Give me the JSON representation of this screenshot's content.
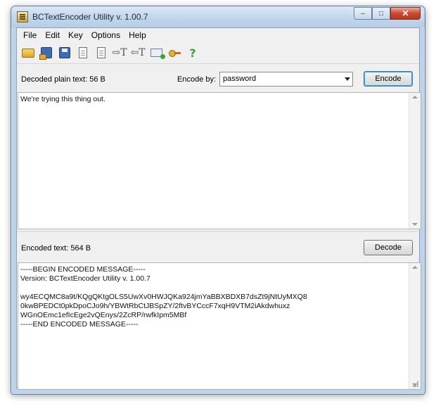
{
  "window": {
    "title": "BCTextEncoder Utility v. 1.00.7",
    "caption_buttons": {
      "minimize": "–",
      "maximize": "□",
      "close": "✕"
    }
  },
  "menu": [
    "File",
    "Edit",
    "Key",
    "Options",
    "Help"
  ],
  "toolbar": {
    "icons": [
      "open-folder",
      "save-as",
      "save",
      "copy",
      "paste",
      "align-right",
      "align-left",
      "send-email",
      "key-manager",
      "help"
    ]
  },
  "plain_section": {
    "label": "Decoded plain text: 56 B",
    "encode_by_label": "Encode by:",
    "encode_by_value": "password",
    "encode_button": "Encode",
    "text": "We're trying this thing out."
  },
  "encoded_section": {
    "label": "Encoded text: 564 B",
    "decode_button": "Decode",
    "text": "-----BEGIN ENCODED MESSAGE-----\nVersion: BCTextEncoder Utility v. 1.00.7\n\nwy4ECQMC8a9t/KQgQKtgOLS5UwXv0HWJQKa924jmYaBBXBDXB7dsZt9jNtUyMXQ8\n0kwBPEDCt0pkDpoCJo9h/YBWtRbCtJBSpZY/2ftvBYCccF7xqH9VTM2iAkdwhuxz\nWGnOEmc1efIcEge2vQEnys/2ZcRP/rwfkIpm5MBf\n-----END ENCODED MESSAGE-----"
  },
  "colors": {
    "title_bar": "#c2d6ec",
    "client_bg": "#f0f0f0",
    "close_button": "#c94a2e",
    "focus_border": "#3ca0e0"
  }
}
